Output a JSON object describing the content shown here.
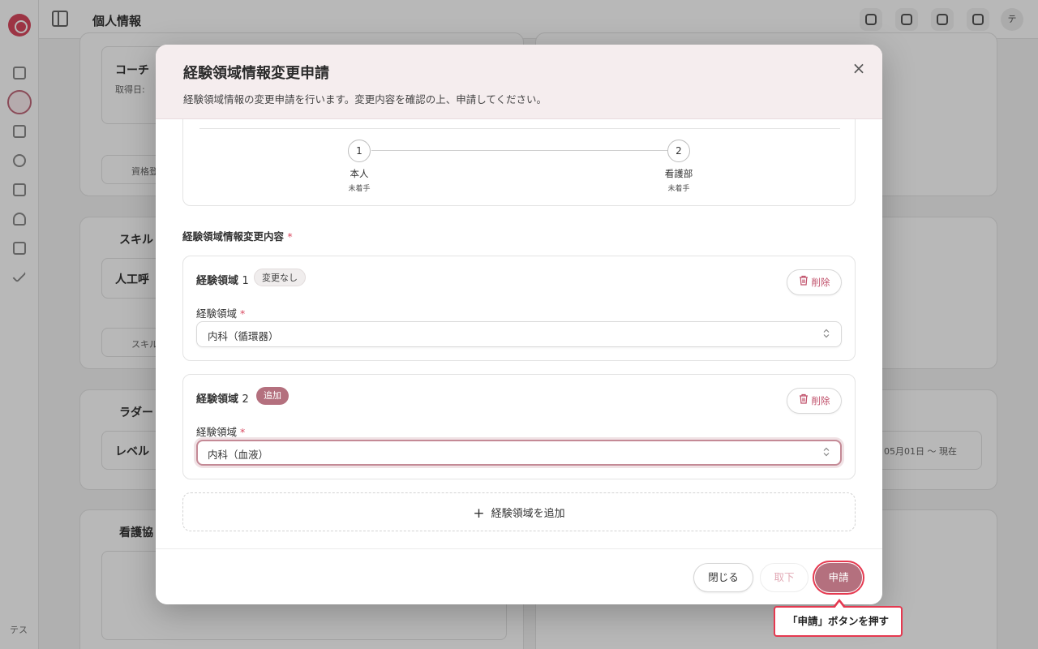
{
  "background": {
    "page_title": "個人情報",
    "sidebar_avatar": "テス",
    "topbar_avatar": "テ",
    "cards": {
      "card1_title": "コーチ",
      "card1_meta": "取得日:",
      "card1_button": "資格登",
      "card2_title": "スキル",
      "card2_inner": "人工呼",
      "card2_button": "スキル",
      "card3_title": "ラダー",
      "card3_inner": "レベル",
      "card4_title": "看護協",
      "right_date": "05月01日 〜 現在"
    }
  },
  "modal": {
    "title": "経験領域情報変更申請",
    "description": "経験領域情報の変更申請を行います。変更内容を確認の上、申請してください。",
    "close_symbol": "×",
    "flow": {
      "steps": [
        {
          "number": "1",
          "name": "本人",
          "status": "未着手"
        },
        {
          "number": "2",
          "name": "看護部",
          "status": "未着手"
        }
      ]
    },
    "section_label": "経験領域情報変更内容",
    "required_mark": "*",
    "areas": [
      {
        "title": "経験領域",
        "number": "1",
        "badge": "変更なし",
        "delete_label": "削除",
        "field_label": "経験領域",
        "value": "内科（循環器）"
      },
      {
        "title": "経験領域",
        "number": "2",
        "badge": "追加",
        "delete_label": "削除",
        "field_label": "経験領域",
        "value": "内科（血液）"
      }
    ],
    "add_area_label": "経験領域を追加",
    "footer": {
      "close_label": "閉じる",
      "withdraw_label": "取下",
      "submit_label": "申請"
    }
  },
  "callout": {
    "text": "「申請」ボタンを押す"
  },
  "colors": {
    "accent": "#b4707e",
    "highlight": "#e53950",
    "header_bg": "#f5edee"
  }
}
